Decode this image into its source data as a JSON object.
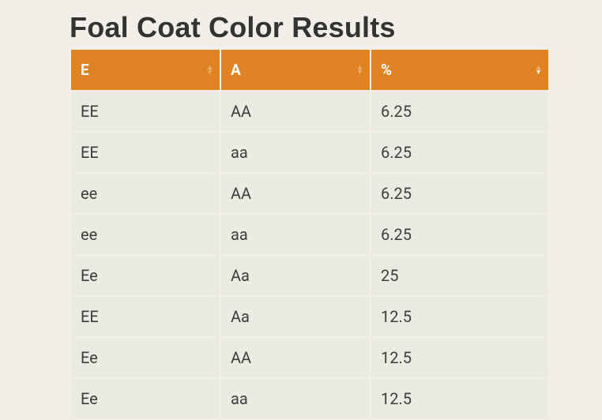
{
  "title": "Foal Coat Color Results",
  "columns": [
    "E",
    "A",
    "%"
  ],
  "sortedColumn": 2,
  "sortDirection": "desc",
  "rows": [
    {
      "e": "EE",
      "a": "AA",
      "pct": "6.25"
    },
    {
      "e": "EE",
      "a": "aa",
      "pct": "6.25"
    },
    {
      "e": "ee",
      "a": "AA",
      "pct": "6.25"
    },
    {
      "e": "ee",
      "a": "aa",
      "pct": "6.25"
    },
    {
      "e": "Ee",
      "a": "Aa",
      "pct": "25"
    },
    {
      "e": "EE",
      "a": "Aa",
      "pct": "12.5"
    },
    {
      "e": "Ee",
      "a": "AA",
      "pct": "12.5"
    },
    {
      "e": "Ee",
      "a": "aa",
      "pct": "12.5"
    }
  ]
}
